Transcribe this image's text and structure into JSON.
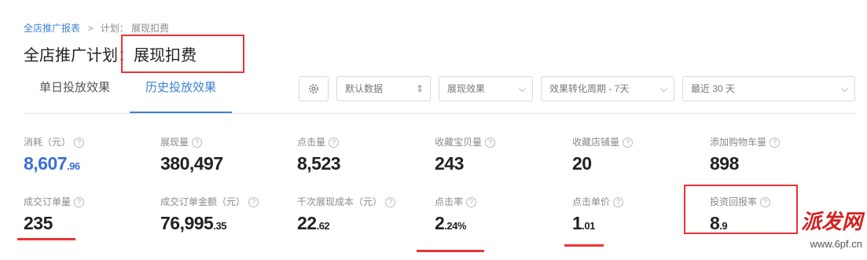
{
  "breadcrumb": {
    "root": "全店推广报表",
    "sep": ">",
    "current": "计划： 展现扣费"
  },
  "title": {
    "prefix": "全店推广计划：",
    "name": "展现扣费"
  },
  "tabs": [
    {
      "label": "单日投放效果",
      "active": false
    },
    {
      "label": "历史投放效果",
      "active": true
    }
  ],
  "controls": {
    "gear_icon": "gear-icon",
    "data_select": "默认数据",
    "type_select": "展现效果",
    "cycle_select": "效果转化周期 - 7天",
    "range_select": "最近 30 天"
  },
  "metrics": [
    {
      "label": "消耗（元）",
      "int": "8,607",
      "dec": ".96",
      "accent": "#3b6fd6"
    },
    {
      "label": "展现量",
      "int": "380,497",
      "dec": ""
    },
    {
      "label": "点击量",
      "int": "8,523",
      "dec": ""
    },
    {
      "label": "收藏宝贝量",
      "int": "243",
      "dec": ""
    },
    {
      "label": "收藏店铺量",
      "int": "20",
      "dec": ""
    },
    {
      "label": "添加购物车量",
      "int": "898",
      "dec": ""
    },
    {
      "label": "成交订单量",
      "int": "235",
      "dec": ""
    },
    {
      "label": "成交订单金额（元）",
      "int": "76,995",
      "dec": ".35"
    },
    {
      "label": "千次展现成本（元）",
      "int": "22",
      "dec": ".62"
    },
    {
      "label": "点击率",
      "int": "2",
      "dec": ".24%"
    },
    {
      "label": "点击单价",
      "int": "1",
      "dec": ".01"
    },
    {
      "label": "投资回报率",
      "int": "8",
      "dec": ".9"
    }
  ],
  "watermark": {
    "text": "派发网",
    "url": "www.6pf.cn"
  },
  "colors": {
    "accent": "#3b82d6",
    "highlight": "#e33333"
  }
}
